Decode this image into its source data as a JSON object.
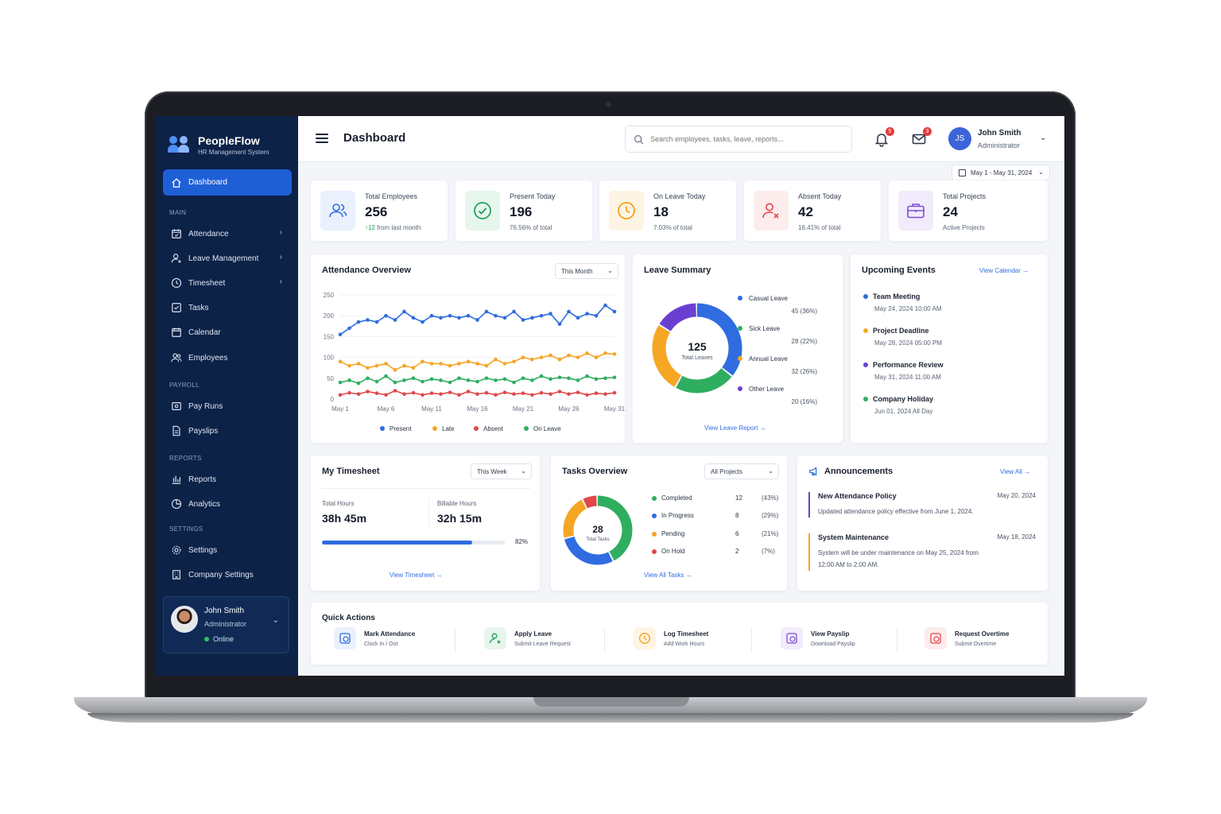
{
  "brand": {
    "name": "PeopleFlow",
    "subtitle": "HR Management System"
  },
  "sidebar": {
    "active": {
      "label": "Dashboard",
      "icon": "home-icon"
    },
    "sections": {
      "main": "MAIN",
      "payroll": "PAYROLL",
      "reports": "REPORTS",
      "settings": "SETTINGS"
    },
    "items": [
      {
        "label": "Attendance",
        "icon": "calendar-check-icon",
        "has_chevron": true
      },
      {
        "label": "Leave Management",
        "icon": "user-leave-icon",
        "has_chevron": true
      },
      {
        "label": "Timesheet",
        "icon": "clock-icon",
        "has_chevron": true
      },
      {
        "label": "Tasks",
        "icon": "checkbox-icon",
        "has_chevron": false
      },
      {
        "label": "Calendar",
        "icon": "calendar-icon",
        "has_chevron": false
      },
      {
        "label": "Employees",
        "icon": "users-icon",
        "has_chevron": false
      },
      {
        "label": "Pay Runs",
        "icon": "wallet-icon",
        "has_chevron": false
      },
      {
        "label": "Payslips",
        "icon": "document-icon",
        "has_chevron": false
      },
      {
        "label": "Reports",
        "icon": "bar-chart-icon",
        "has_chevron": false
      },
      {
        "label": "Analytics",
        "icon": "pie-chart-icon",
        "has_chevron": false
      },
      {
        "label": "Settings",
        "icon": "gear-icon",
        "has_chevron": false
      },
      {
        "label": "Company Settings",
        "icon": "building-icon",
        "has_chevron": false
      }
    ],
    "user": {
      "name": "John Smith",
      "role": "Administrator",
      "status": "Online"
    }
  },
  "header": {
    "title": "Dashboard",
    "search_placeholder": "Search employees, tasks, leave, reports...",
    "notifications_count": "5",
    "messages_count": "3",
    "user_initials": "JS",
    "user_name": "John Smith",
    "user_role": "Administrator",
    "date_range": "May 1 - May 31, 2024"
  },
  "stats": [
    {
      "label": "Total Employees",
      "value": "256",
      "sub_up": "↑12",
      "sub": "from last month",
      "color": "#2f6ce0",
      "bg": "#eaf1fd"
    },
    {
      "label": "Present Today",
      "value": "196",
      "sub": "76.56% of total",
      "color": "#1f9d55",
      "bg": "#e6f6ed"
    },
    {
      "label": "On Leave Today",
      "value": "18",
      "sub": "7.03% of total",
      "color": "#f39c12",
      "bg": "#fef4e4"
    },
    {
      "label": "Absent Today",
      "value": "42",
      "sub": "16.41% of total",
      "color": "#e0484a",
      "bg": "#fdecec"
    },
    {
      "label": "Total Projects",
      "value": "24",
      "sub": "Active Projects",
      "color": "#7b4fd6",
      "bg": "#f1ebfc"
    }
  ],
  "attendance": {
    "title": "Attendance Overview",
    "filter": "This Month"
  },
  "chart_data": [
    {
      "type": "line",
      "title": "Attendance Overview",
      "ylim": [
        0,
        250
      ],
      "yticks": [
        0,
        50,
        100,
        150,
        200,
        250
      ],
      "xtick_labels": [
        "May 1",
        "May 6",
        "May 11",
        "May 16",
        "May 21",
        "May 26",
        "May 31"
      ],
      "x": [
        1,
        2,
        3,
        4,
        5,
        6,
        7,
        8,
        9,
        10,
        11,
        12,
        13,
        14,
        15,
        16,
        17,
        18,
        19,
        20,
        21,
        22,
        23,
        24,
        25,
        26,
        27,
        28,
        29,
        30,
        31
      ],
      "series": [
        {
          "name": "Present",
          "color": "#2f6ce0",
          "values": [
            155,
            170,
            185,
            190,
            185,
            200,
            190,
            210,
            195,
            185,
            200,
            195,
            200,
            195,
            200,
            190,
            210,
            200,
            195,
            210,
            190,
            195,
            200,
            205,
            180,
            210,
            195,
            205,
            200,
            225,
            210
          ]
        },
        {
          "name": "Late",
          "color": "#f5a623",
          "values": [
            90,
            80,
            85,
            75,
            80,
            85,
            70,
            80,
            75,
            90,
            85,
            85,
            80,
            85,
            90,
            85,
            80,
            95,
            85,
            90,
            100,
            95,
            100,
            105,
            95,
            105,
            100,
            110,
            100,
            110,
            108
          ]
        },
        {
          "name": "Absent",
          "color": "#e0484a",
          "values": [
            10,
            15,
            12,
            18,
            14,
            10,
            20,
            12,
            15,
            10,
            14,
            12,
            16,
            10,
            18,
            12,
            15,
            10,
            16,
            12,
            14,
            10,
            15,
            12,
            18,
            12,
            16,
            10,
            14,
            12,
            15
          ]
        },
        {
          "name": "On Leave",
          "color": "#2fae5f",
          "values": [
            40,
            45,
            38,
            50,
            42,
            55,
            40,
            45,
            50,
            42,
            48,
            45,
            40,
            50,
            45,
            42,
            50,
            45,
            48,
            40,
            50,
            45,
            55,
            48,
            52,
            50,
            45,
            55,
            48,
            50,
            52
          ]
        }
      ]
    },
    {
      "type": "pie",
      "title": "Leave Summary",
      "center_value": "125",
      "center_label": "Total Leaves",
      "slices": [
        {
          "name": "Casual Leave",
          "value": 45,
          "pct": "45 (36%)",
          "color": "#2f6ce0"
        },
        {
          "name": "Sick Leave",
          "value": 28,
          "pct": "28 (22%)",
          "color": "#2fae5f"
        },
        {
          "name": "Annual Leave",
          "value": 32,
          "pct": "32 (26%)",
          "color": "#f5a623"
        },
        {
          "name": "Other Leave",
          "value": 20,
          "pct": "20 (16%)",
          "color": "#6a3fd0"
        }
      ]
    },
    {
      "type": "pie",
      "title": "Tasks Overview",
      "center_value": "28",
      "center_label": "Total Tasks",
      "slices": [
        {
          "name": "Completed",
          "value": 12,
          "pct": "(43%)",
          "color": "#2fae5f"
        },
        {
          "name": "In Progress",
          "value": 8,
          "pct": "(29%)",
          "color": "#2f6ce0"
        },
        {
          "name": "Pending",
          "value": 6,
          "pct": "(21%)",
          "color": "#f5a623"
        },
        {
          "name": "On Hold",
          "value": 2,
          "pct": "(7%)",
          "color": "#e0484a"
        }
      ]
    }
  ],
  "leave_summary": {
    "title": "Leave Summary",
    "link": "View Leave Report →"
  },
  "events": {
    "title": "Upcoming Events",
    "link": "View Calendar →",
    "items": [
      {
        "title": "Team Meeting",
        "date": "May 24, 2024 10:00 AM",
        "color": "#2f6ce0"
      },
      {
        "title": "Project Deadline",
        "date": "May 28, 2024 05:00 PM",
        "color": "#f5a623"
      },
      {
        "title": "Performance Review",
        "date": "May 31, 2024 11:00 AM",
        "color": "#6a3fd0"
      },
      {
        "title": "Company Holiday",
        "date": "Jun 01, 2024 All Day",
        "color": "#2fae5f"
      }
    ]
  },
  "timesheet": {
    "title": "My Timesheet",
    "filter": "This Week",
    "total_label": "Total Hours",
    "total_value": "38h 45m",
    "billable_label": "Billable Hours",
    "billable_value": "32h 15m",
    "progress": 0.82,
    "progress_label": "82%",
    "link": "View Timesheet →"
  },
  "tasks": {
    "title": "Tasks Overview",
    "filter": "All Projects",
    "rows": [
      {
        "label": "Completed",
        "count": "12",
        "pct": "(43%)",
        "color": "#2fae5f"
      },
      {
        "label": "In Progress",
        "count": "8",
        "pct": "(29%)",
        "color": "#2f6ce0"
      },
      {
        "label": "Pending",
        "count": "6",
        "pct": "(21%)",
        "color": "#f5a623"
      },
      {
        "label": "On Hold",
        "count": "2",
        "pct": "(7%)",
        "color": "#e0484a"
      }
    ],
    "link": "View All Tasks →"
  },
  "announcements": {
    "title": "Announcements",
    "link": "View All →",
    "items": [
      {
        "title": "New Attendance Policy",
        "date": "May 20, 2024",
        "body": "Updated attendance policy effective from June 1, 2024.",
        "color": "#6a3fd0"
      },
      {
        "title": "System Maintenance",
        "date": "May 18, 2024",
        "body": "System will be under maintenance on May 25, 2024 from 12:00 AM to 2:00 AM.",
        "color": "#f5a623"
      }
    ]
  },
  "quick_actions": {
    "title": "Quick Actions",
    "items": [
      {
        "title": "Mark Attendance",
        "sub": "Clock In / Out",
        "color": "#2f6ce0",
        "bg": "#eaf1fd",
        "icon": "clock-in-icon"
      },
      {
        "title": "Apply Leave",
        "sub": "Submit Leave Request",
        "color": "#1f9d55",
        "bg": "#e6f6ed",
        "icon": "user-leave-icon"
      },
      {
        "title": "Log Timesheet",
        "sub": "Add Work Hours",
        "color": "#f39c12",
        "bg": "#fef4e4",
        "icon": "clock-icon"
      },
      {
        "title": "View Payslip",
        "sub": "Download Payslip",
        "color": "#7b4fd6",
        "bg": "#f1ebfc",
        "icon": "payslip-icon"
      },
      {
        "title": "Request Overtime",
        "sub": "Submit Overtime",
        "color": "#e0484a",
        "bg": "#fdecec",
        "icon": "overtime-icon"
      }
    ]
  }
}
